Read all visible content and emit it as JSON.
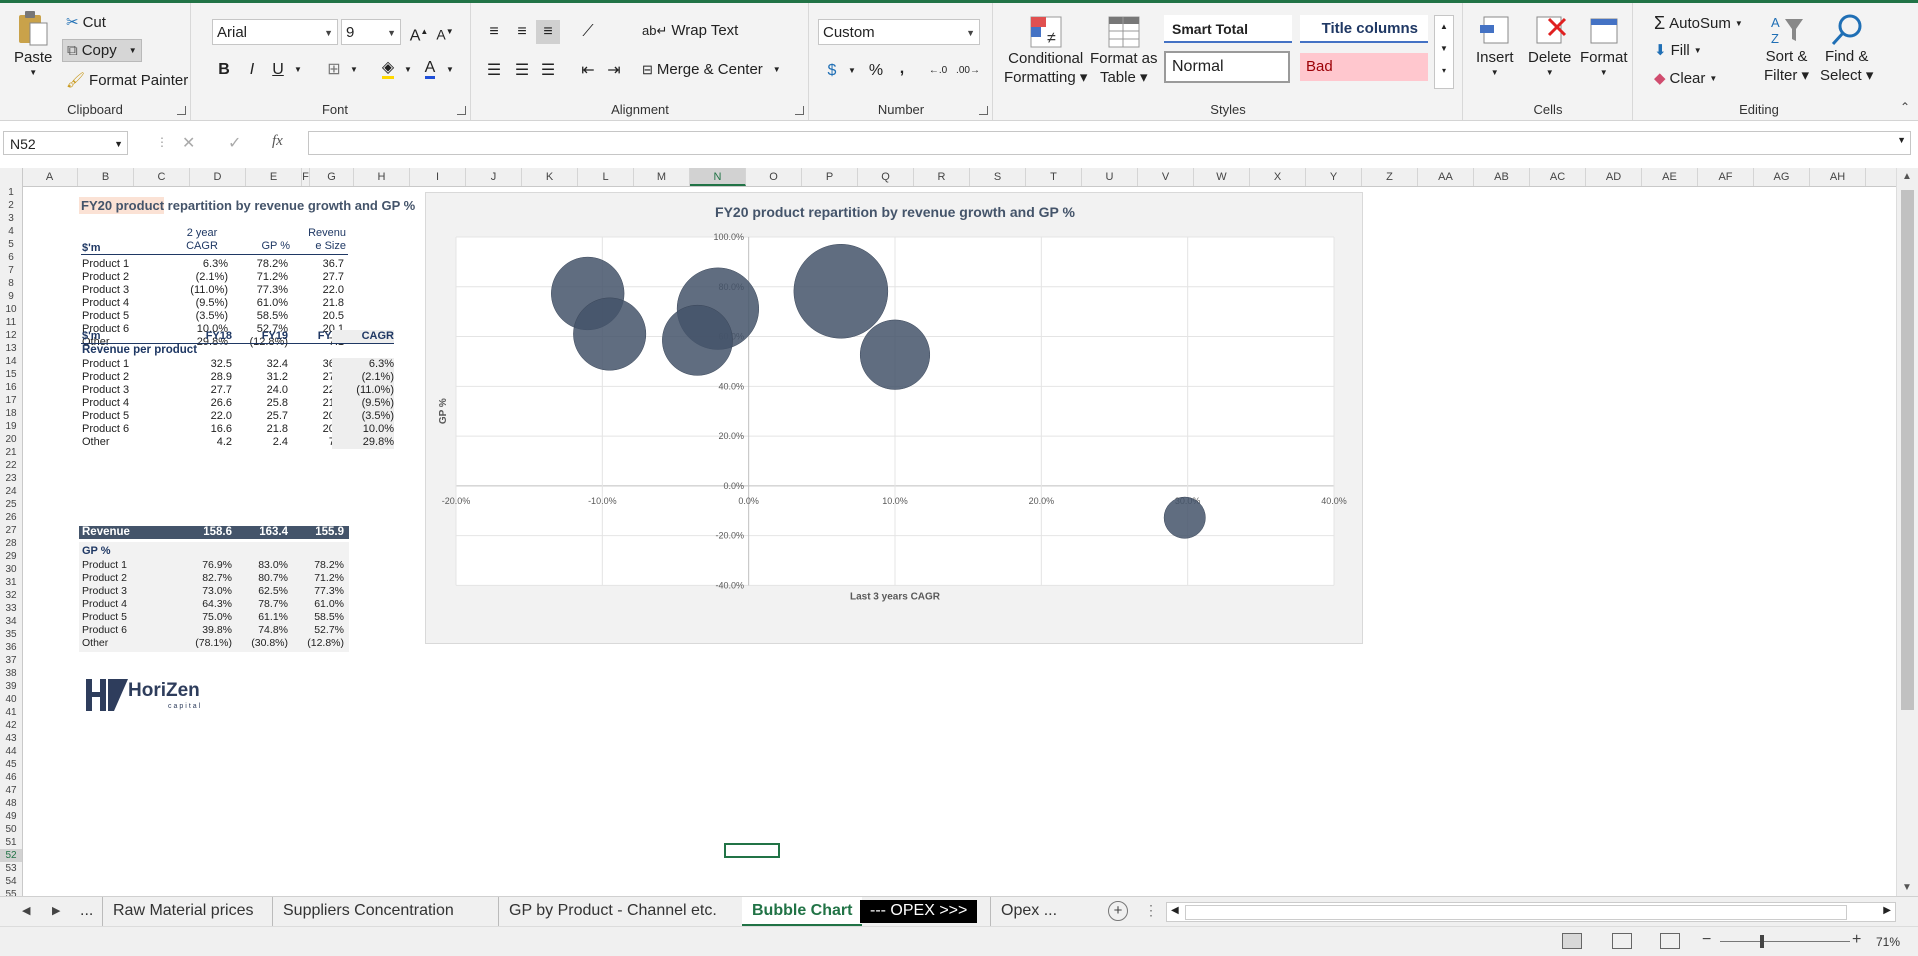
{
  "ribbon": {
    "clipboard": {
      "paste": "Paste",
      "cut": "Cut",
      "copy": "Copy",
      "format_painter": "Format Painter",
      "label": "Clipboard"
    },
    "font": {
      "name": "Arial",
      "size": "9",
      "bold": "B",
      "italic": "I",
      "underline": "U",
      "label": "Font"
    },
    "alignment": {
      "wrap_text": "Wrap Text",
      "merge_center": "Merge & Center",
      "label": "Alignment"
    },
    "number": {
      "format": "Custom",
      "percent": "%",
      "comma": ",",
      "label": "Number"
    },
    "styles": {
      "conditional": "Conditional",
      "conditional2": "Formatting",
      "format_table": "Format as",
      "format_table2": "Table",
      "smart_total": "Smart Total",
      "title_columns": "Title columns",
      "normal": "Normal",
      "bad": "Bad",
      "label": "Styles"
    },
    "cells": {
      "insert": "Insert",
      "delete": "Delete",
      "format": "Format",
      "label": "Cells"
    },
    "editing": {
      "autosum": "AutoSum",
      "fill": "Fill",
      "clear": "Clear",
      "sort_filter": "Sort &",
      "sort_filter2": "Filter",
      "find_select": "Find &",
      "find_select2": "Select",
      "label": "Editing"
    }
  },
  "formula_bar": {
    "name_box": "N52",
    "fx": "fx",
    "cancel": "✕",
    "enter": "✓"
  },
  "columns": [
    "A",
    "B",
    "C",
    "D",
    "E",
    "F",
    "G",
    "H",
    "I",
    "J",
    "K",
    "L",
    "M",
    "N",
    "O",
    "P",
    "Q",
    "R",
    "S",
    "T",
    "U",
    "V",
    "W",
    "X",
    "Y",
    "Z",
    "AA",
    "AB",
    "AC",
    "AD",
    "AE",
    "AF",
    "AG",
    "AH"
  ],
  "rows": [
    "1",
    "2",
    "3",
    "4",
    "5",
    "6",
    "7",
    "8",
    "9",
    "10",
    "11",
    "12",
    "13",
    "14",
    "15",
    "16",
    "17",
    "18",
    "19",
    "20",
    "21",
    "22",
    "23",
    "24",
    "25",
    "26",
    "27",
    "28",
    "29",
    "30",
    "31",
    "32",
    "33",
    "34",
    "35",
    "36",
    "37",
    "38",
    "39",
    "40",
    "41",
    "42",
    "43",
    "44",
    "45",
    "46",
    "47",
    "48",
    "49",
    "50",
    "51",
    "52",
    "53",
    "54",
    "55"
  ],
  "sheet": {
    "title": "FY20 product repartition by revenue growth and GP %",
    "table1": {
      "unit": "$'m",
      "h_cagr1": "2 year",
      "h_cagr2": "CAGR",
      "h_gp": "GP %",
      "h_rev1": "Revenu",
      "h_rev2": "e Size",
      "rows": [
        {
          "name": "Product 1",
          "cagr": "6.3%",
          "gp": "78.2%",
          "rev": "36.7"
        },
        {
          "name": "Product 2",
          "cagr": "(2.1%)",
          "gp": "71.2%",
          "rev": "27.7"
        },
        {
          "name": "Product 3",
          "cagr": "(11.0%)",
          "gp": "77.3%",
          "rev": "22.0"
        },
        {
          "name": "Product 4",
          "cagr": "(9.5%)",
          "gp": "61.0%",
          "rev": "21.8"
        },
        {
          "name": "Product 5",
          "cagr": "(3.5%)",
          "gp": "58.5%",
          "rev": "20.5"
        },
        {
          "name": "Product 6",
          "cagr": "10.0%",
          "gp": "52.7%",
          "rev": "20.1"
        },
        {
          "name": "Other",
          "cagr": "29.8%",
          "gp": "(12.8%)",
          "rev": "7.1"
        }
      ]
    },
    "table2": {
      "unit": "$'m",
      "fy18": "FY18",
      "fy19": "FY19",
      "fy20": "FY20",
      "cagr": "CAGR",
      "section1": "Revenue per product",
      "rows": [
        {
          "name": "Product 1",
          "fy18": "32.5",
          "fy19": "32.4",
          "fy20": "36.7",
          "cagr": "6.3%"
        },
        {
          "name": "Product 2",
          "fy18": "28.9",
          "fy19": "31.2",
          "fy20": "27.7",
          "cagr": "(2.1%)"
        },
        {
          "name": "Product 3",
          "fy18": "27.7",
          "fy19": "24.0",
          "fy20": "22.0",
          "cagr": "(11.0%)"
        },
        {
          "name": "Product 4",
          "fy18": "26.6",
          "fy19": "25.8",
          "fy20": "21.8",
          "cagr": "(9.5%)"
        },
        {
          "name": "Product 5",
          "fy18": "22.0",
          "fy19": "25.7",
          "fy20": "20.5",
          "cagr": "(3.5%)"
        },
        {
          "name": "Product 6",
          "fy18": "16.6",
          "fy19": "21.8",
          "fy20": "20.1",
          "cagr": "10.0%"
        },
        {
          "name": "Other",
          "fy18": "4.2",
          "fy19": "2.4",
          "fy20": "7.1",
          "cagr": "29.8%"
        }
      ],
      "total": {
        "name": "Revenue",
        "fy18": "158.6",
        "fy19": "163.4",
        "fy20": "155.9"
      },
      "section2": "GP %",
      "gp_rows": [
        {
          "name": "Product 1",
          "fy18": "76.9%",
          "fy19": "83.0%",
          "fy20": "78.2%"
        },
        {
          "name": "Product 2",
          "fy18": "82.7%",
          "fy19": "80.7%",
          "fy20": "71.2%"
        },
        {
          "name": "Product 3",
          "fy18": "73.0%",
          "fy19": "62.5%",
          "fy20": "77.3%"
        },
        {
          "name": "Product 4",
          "fy18": "64.3%",
          "fy19": "78.7%",
          "fy20": "61.0%"
        },
        {
          "name": "Product 5",
          "fy18": "75.0%",
          "fy19": "61.1%",
          "fy20": "58.5%"
        },
        {
          "name": "Product 6",
          "fy18": "39.8%",
          "fy19": "74.8%",
          "fy20": "52.7%"
        },
        {
          "name": "Other",
          "fy18": "(78.1%)",
          "fy19": "(30.8%)",
          "fy20": "(12.8%)"
        }
      ]
    },
    "logo_text": "HoriZen",
    "logo_sub": "capital"
  },
  "chart_data": {
    "type": "bubble",
    "title": "FY20 product repartition by revenue growth and GP %",
    "xlabel": "Last 3 years CAGR",
    "ylabel": "GP %",
    "xlim": [
      -20,
      40
    ],
    "ylim": [
      -40,
      100
    ],
    "xticks": [
      "-20.0%",
      "-10.0%",
      "0.0%",
      "10.0%",
      "20.0%",
      "30.0%",
      "40.0%"
    ],
    "yticks": [
      "100.0%",
      "80.0%",
      "60.0%",
      "40.0%",
      "20.0%",
      "0.0%",
      "-20.0%",
      "-40.0%"
    ],
    "bubble_color": "#44546a",
    "points": [
      {
        "x": 6.3,
        "y": 78.2,
        "size": 36.7
      },
      {
        "x": -2.1,
        "y": 71.2,
        "size": 27.7
      },
      {
        "x": -11.0,
        "y": 77.3,
        "size": 22.0
      },
      {
        "x": -9.5,
        "y": 61.0,
        "size": 21.8
      },
      {
        "x": -3.5,
        "y": 58.5,
        "size": 20.5
      },
      {
        "x": 10.0,
        "y": 52.7,
        "size": 20.1
      },
      {
        "x": 29.8,
        "y": -12.8,
        "size": 7.1
      }
    ]
  },
  "tabs": [
    {
      "label": "...",
      "active": false
    },
    {
      "label": "Raw Material prices",
      "active": false
    },
    {
      "label": "Suppliers Concentration",
      "active": false
    },
    {
      "label": "GP by Product - Channel etc.",
      "active": false
    },
    {
      "label": "Bubble Chart",
      "active": true
    },
    {
      "label": "--- OPEX >>>",
      "active": false,
      "dark": true
    },
    {
      "label": "Opex ...",
      "active": false
    }
  ],
  "status": {
    "zoom": "71%",
    "minus": "−",
    "plus": "+"
  }
}
